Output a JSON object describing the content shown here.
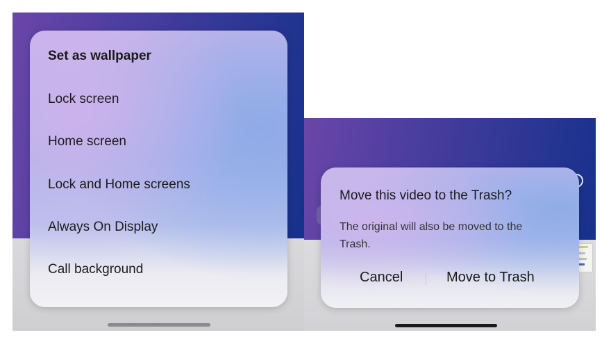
{
  "wallpaper_menu": {
    "title": "Set as wallpaper",
    "items": [
      {
        "label": "Lock screen"
      },
      {
        "label": "Home screen"
      },
      {
        "label": "Lock and Home screens"
      },
      {
        "label": "Always On Display"
      },
      {
        "label": "Call background"
      }
    ]
  },
  "trash_dialog": {
    "title": "Move this video to the Trash?",
    "message": "The original will also be moved to the Trash.",
    "cancel_label": "Cancel",
    "confirm_label": "Move to Trash"
  },
  "colors": {
    "wallpaper_gradient_start": "#6a46a8",
    "wallpaper_gradient_end": "#12308a",
    "text_primary": "#1a1a1a"
  }
}
